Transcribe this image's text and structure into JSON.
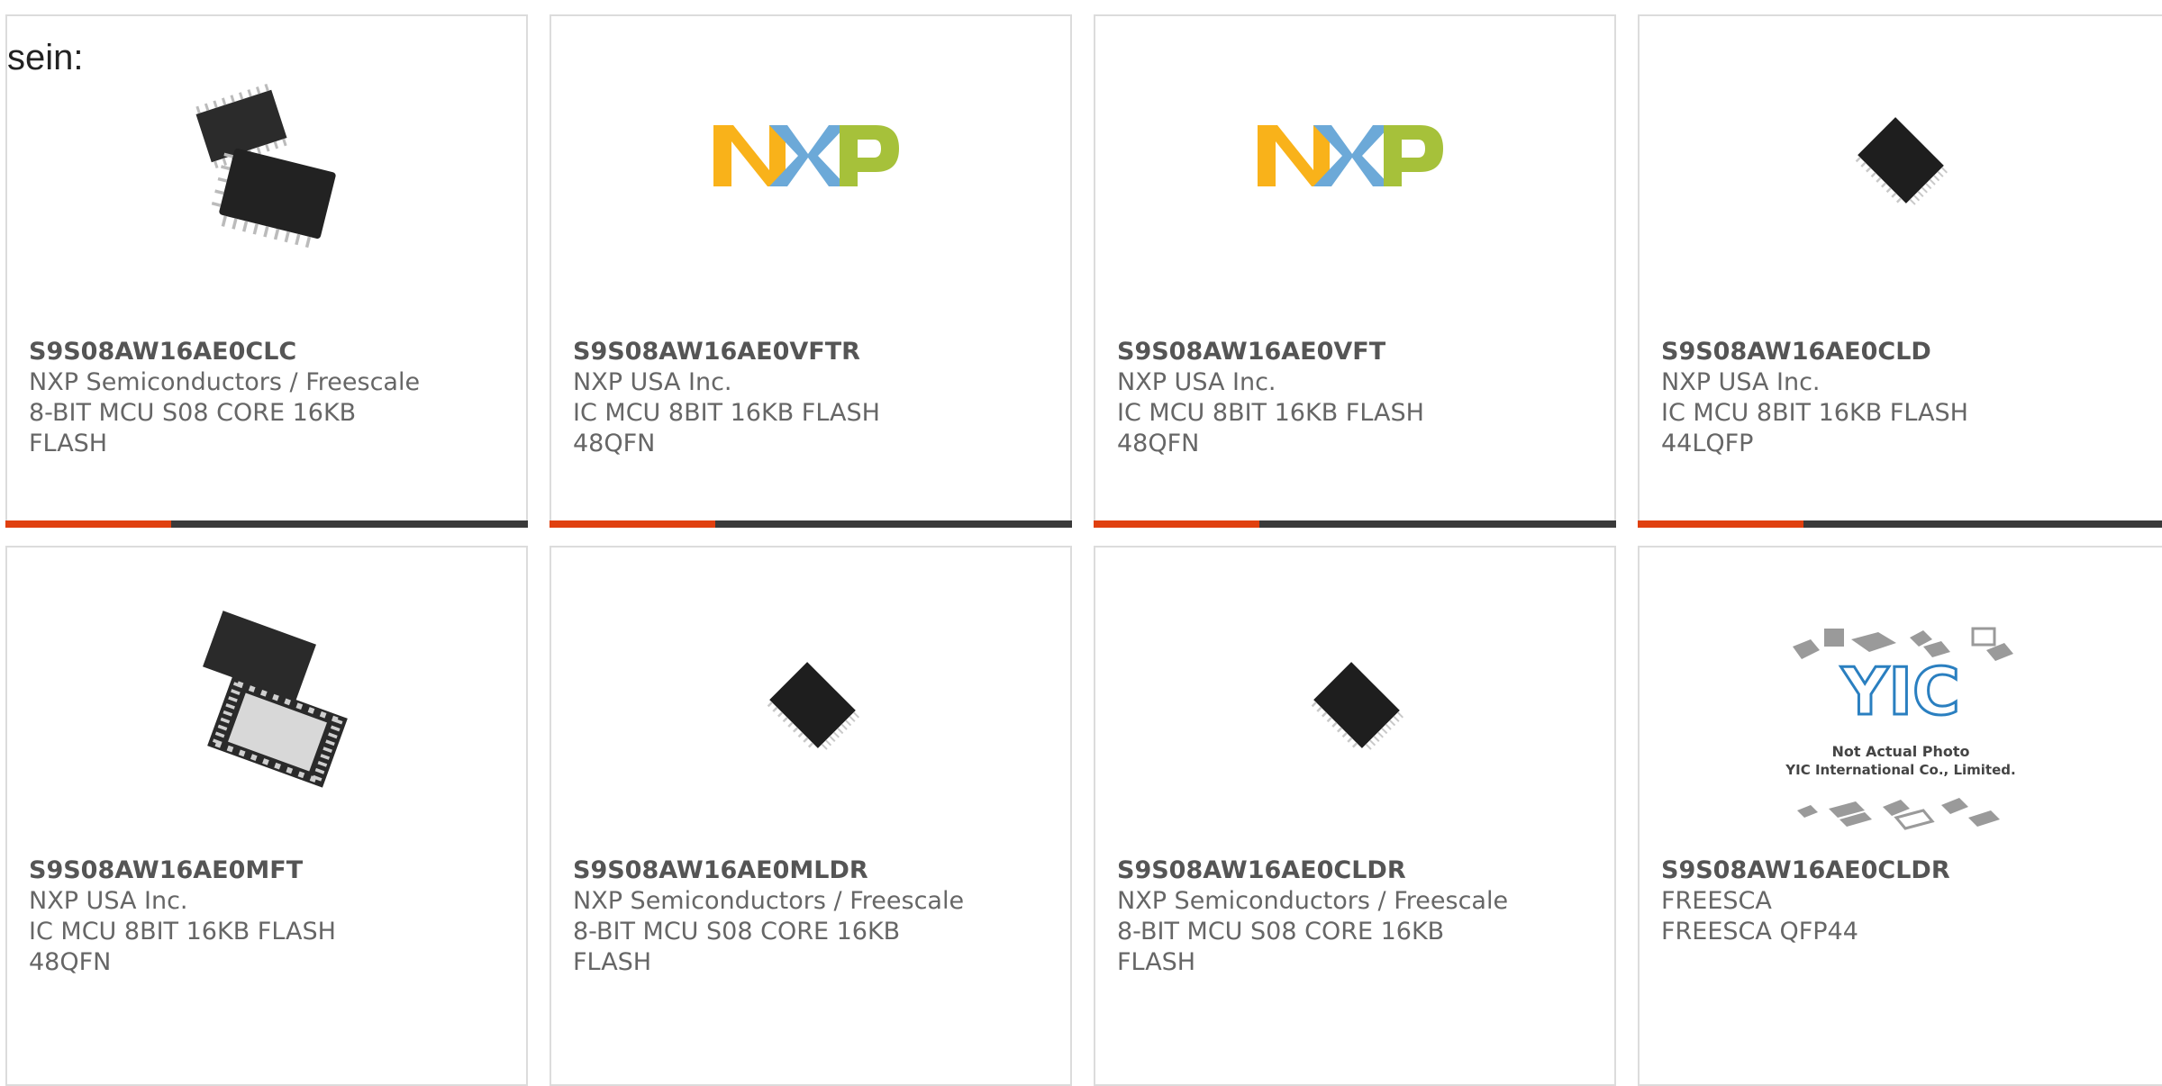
{
  "intro_text": "sein:",
  "colors": {
    "accent": "#e0400f",
    "bar": "#3a3a3a",
    "border": "#dcdcdc"
  },
  "products": [
    {
      "part_number": "S9S08AW16AE0CLC",
      "manufacturer": "NXP Semiconductors / Freescale",
      "description": "8-BIT MCU S08 CORE 16KB FLASH",
      "image": "two-qfp-chips-icon",
      "has_bar": true
    },
    {
      "part_number": "S9S08AW16AE0VFTR",
      "manufacturer": "NXP USA Inc.",
      "description": "IC MCU 8BIT 16KB FLASH 48QFN",
      "image": "nxp-logo",
      "logo_letters": "NXP",
      "has_bar": true
    },
    {
      "part_number": "S9S08AW16AE0VFT",
      "manufacturer": "NXP USA Inc.",
      "description": "IC MCU 8BIT 16KB FLASH 48QFN",
      "image": "nxp-logo",
      "logo_letters": "NXP",
      "has_bar": true
    },
    {
      "part_number": "S9S08AW16AE0CLD",
      "manufacturer": "NXP USA Inc.",
      "description": "IC MCU 8BIT 16KB FLASH 44LQFP",
      "image": "lqfp-chip-icon",
      "has_bar": true
    },
    {
      "part_number": "S9S08AW16AE0MFT",
      "manufacturer": "NXP USA Inc.",
      "description": "IC MCU 8BIT 16KB FLASH 48QFN",
      "image": "qfn-chip-pair-icon",
      "has_bar": false
    },
    {
      "part_number": "S9S08AW16AE0MLDR",
      "manufacturer": "NXP Semiconductors / Freescale",
      "description": "8-BIT MCU S08 CORE 16KB FLASH",
      "image": "lqfp-chip-icon",
      "has_bar": false
    },
    {
      "part_number": "S9S08AW16AE0CLDR",
      "manufacturer": "NXP Semiconductors / Freescale",
      "description": "8-BIT MCU S08 CORE 16KB FLASH",
      "image": "lqfp-chip-icon",
      "has_bar": false
    },
    {
      "part_number": "S9S08AW16AE0CLDR",
      "manufacturer": "FREESCA",
      "description": "FREESCA QFP44",
      "image": "yic-placeholder",
      "placeholder_logo": "YIC",
      "placeholder_line1": "Not Actual Photo",
      "placeholder_line2": "YIC International Co., Limited.",
      "has_bar": false
    }
  ]
}
